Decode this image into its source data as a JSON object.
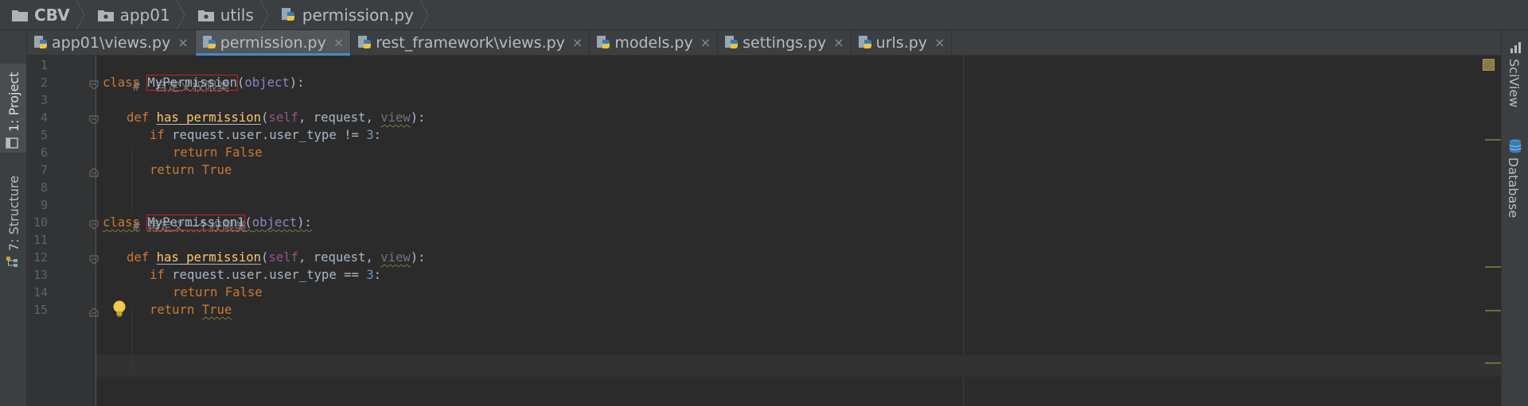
{
  "breadcrumb": [
    {
      "label": "CBV",
      "icon": "folder-icon",
      "bold": true
    },
    {
      "label": "app01",
      "icon": "package-folder-icon",
      "bold": false
    },
    {
      "label": "utils",
      "icon": "package-folder-icon",
      "bold": false
    },
    {
      "label": "permission.py",
      "icon": "python-file-icon",
      "bold": false
    }
  ],
  "left_tools": {
    "project": "1: Project",
    "structure": "7: Structure"
  },
  "right_tools": {
    "sciview": "SciView",
    "database": "Database"
  },
  "tabs": [
    {
      "label": "app01\\views.py",
      "active": false
    },
    {
      "label": "permission.py",
      "active": true
    },
    {
      "label": "rest_framework\\views.py",
      "active": false
    },
    {
      "label": "models.py",
      "active": false
    },
    {
      "label": "settings.py",
      "active": false
    },
    {
      "label": "urls.py",
      "active": false
    }
  ],
  "close_glyph": "×",
  "line_numbers": [
    "1",
    "2",
    "3",
    "4",
    "5",
    "6",
    "7",
    "8",
    "9",
    "10",
    "11",
    "12",
    "13",
    "14",
    "15"
  ],
  "code": {
    "l1": {
      "comment": "#  自定义权限类"
    },
    "l2": {
      "kw": "class",
      "name": "MyPermission",
      "open": "(",
      "base": "object",
      "close": "):"
    },
    "l4": {
      "kw": "def",
      "fn": "has_permission",
      "open": "(",
      "self": "self",
      "c1": ", request, ",
      "view": "view",
      "close": "):"
    },
    "l5": {
      "kw": "if",
      "expr": " request.user.user_type != ",
      "num": "3",
      "colon": ":"
    },
    "l6": {
      "kw": "return",
      "val": "False"
    },
    "l7": {
      "kw": "return",
      "val": "True"
    },
    "l9": {
      "comment": "# 再定义一个权限类"
    },
    "l10": {
      "kw": "class",
      "name": "MyPermission1",
      "open": "(",
      "base": "object",
      "close": "):"
    },
    "l12": {
      "kw": "def",
      "fn": "has_permission",
      "open": "(",
      "self": "self",
      "c1": ", request, ",
      "view": "view",
      "close": "):"
    },
    "l13": {
      "kw": "if",
      "expr": " request.user.user_type == ",
      "num": "3",
      "colon": ":"
    },
    "l14": {
      "kw": "return",
      "val": "False"
    },
    "l15": {
      "kw": "return",
      "val": "True"
    }
  },
  "colors": {
    "keyword": "#cc7832",
    "function": "#ffc66d",
    "number": "#6897bb",
    "comment": "#808080",
    "self": "#94558d",
    "tab_accent": "#4a88c7",
    "highlight_box": "#d02020"
  }
}
